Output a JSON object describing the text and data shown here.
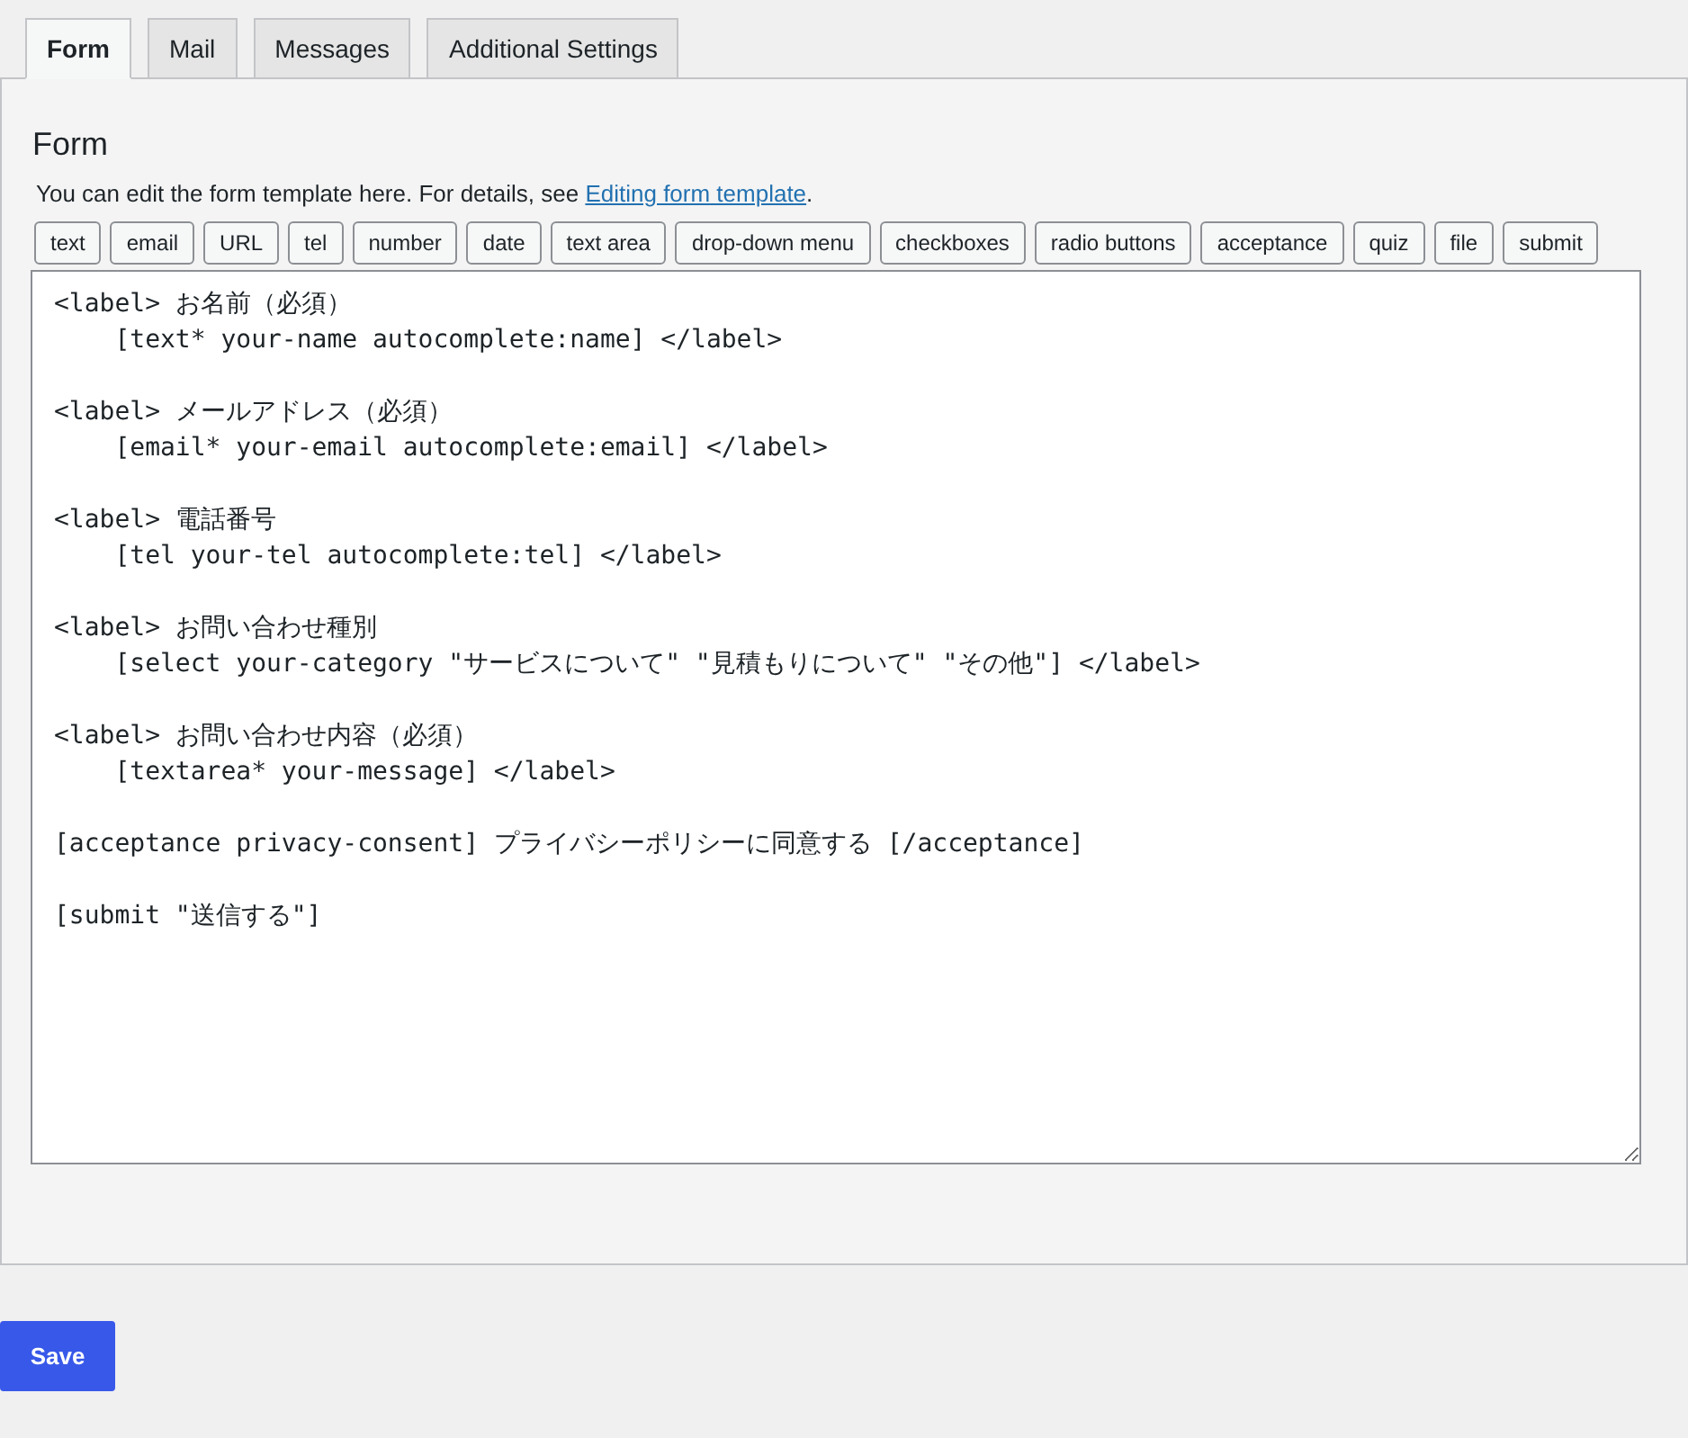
{
  "tabs": [
    {
      "label": "Form",
      "selected": true
    },
    {
      "label": "Mail",
      "selected": false
    },
    {
      "label": "Messages",
      "selected": false
    },
    {
      "label": "Additional Settings",
      "selected": false
    }
  ],
  "panel": {
    "title": "Form",
    "description": {
      "text": "You can edit the form template here. For details, see ",
      "link": "Editing form template",
      "after": "."
    },
    "tag_buttons": [
      "text",
      "email",
      "URL",
      "tel",
      "number",
      "date",
      "text area",
      "drop-down menu",
      "checkboxes",
      "radio buttons",
      "acceptance",
      "quiz",
      "file",
      "submit"
    ],
    "template": "<label> お名前（必須）\n    [text* your-name autocomplete:name] </label>\n\n<label> メールアドレス（必須）\n    [email* your-email autocomplete:email] </label>\n\n<label> 電話番号\n    [tel your-tel autocomplete:tel] </label>\n\n<label> お問い合わせ種別\n    [select your-category \"サービスについて\" \"見積もりについて\" \"その他\"] </label>\n\n<label> お問い合わせ内容（必須）\n    [textarea* your-message] </label>\n\n[acceptance privacy-consent] プライバシーポリシーに同意する [/acceptance]\n\n[submit \"送信する\"]"
  },
  "save_button": "Save"
}
